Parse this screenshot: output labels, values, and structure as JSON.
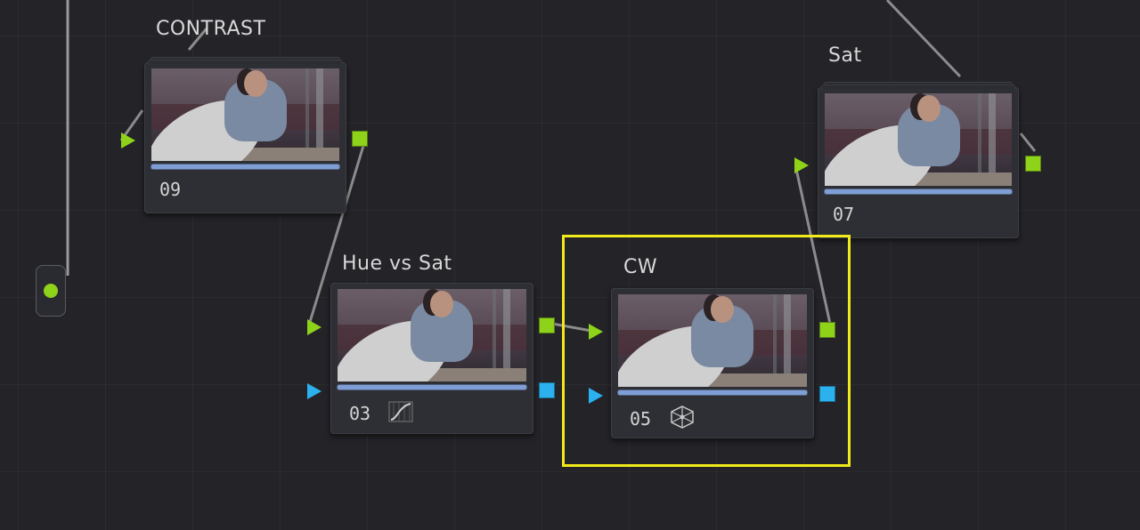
{
  "canvas": {
    "background": "#232328",
    "highlight_color": "#f1ea1a"
  },
  "nodes": {
    "contrast": {
      "label": "CONTRAST",
      "number": "09"
    },
    "sat": {
      "label": "Sat",
      "number": "07"
    },
    "hue_vs_sat": {
      "label": "Hue vs Sat",
      "number": "03",
      "badge_icon": "curve-icon"
    },
    "cw": {
      "label": "CW",
      "number": "05",
      "badge_icon": "color-warper-icon"
    }
  },
  "ports": {
    "rgb_color": "#8fd21a",
    "alpha_color": "#2bb1ee"
  }
}
